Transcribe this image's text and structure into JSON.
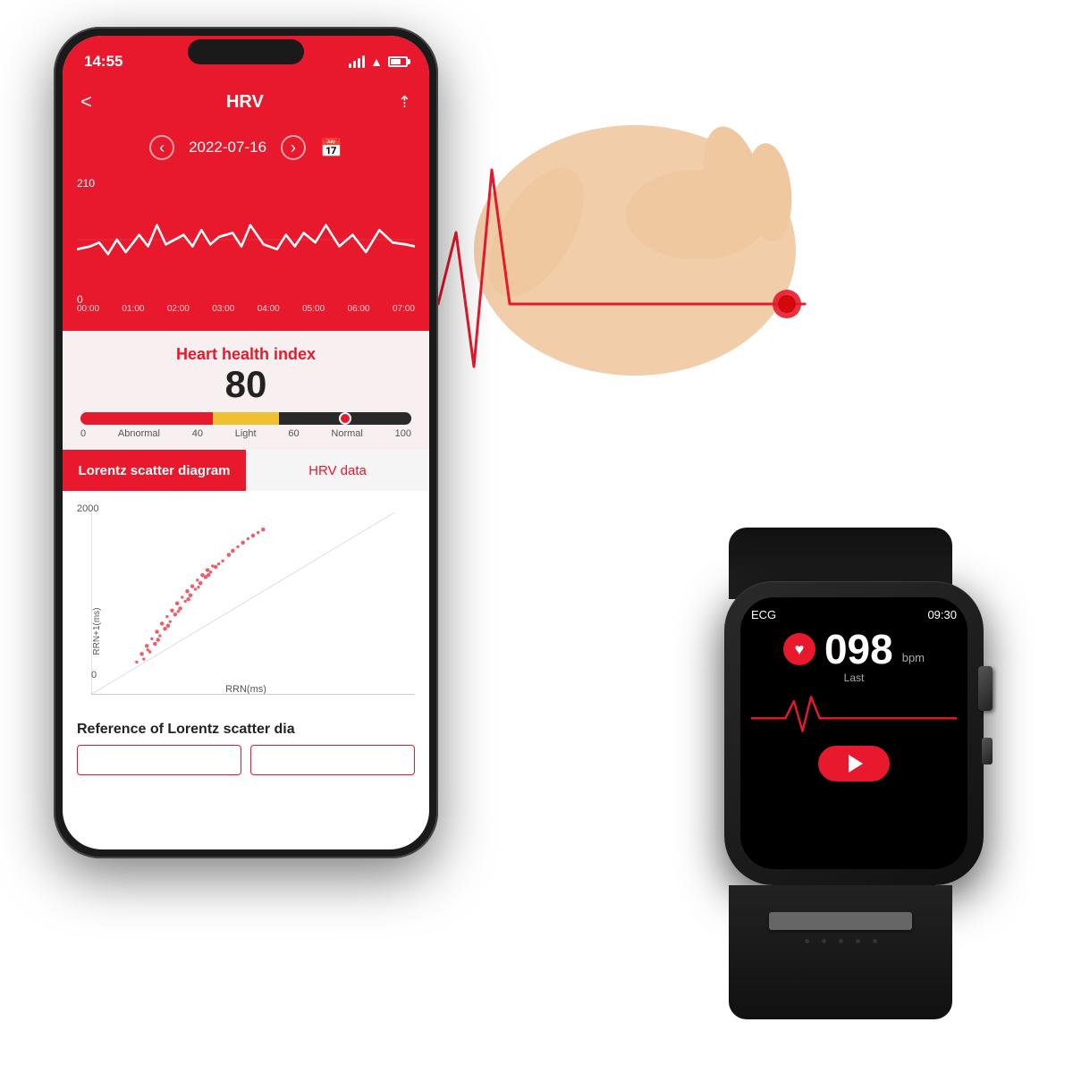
{
  "status_bar": {
    "time": "14:55",
    "signal": "signal",
    "wifi": "wifi",
    "battery": "battery"
  },
  "app": {
    "title": "HRV",
    "back_label": "<",
    "share_label": "share"
  },
  "date_nav": {
    "date": "2022-07-16",
    "prev_label": "<",
    "next_label": ">"
  },
  "chart": {
    "y_max": "210",
    "y_min": "0",
    "x_labels": [
      "00:00",
      "01:00",
      "02:00",
      "03:00",
      "04:00",
      "05:00",
      "06:00",
      "07:00"
    ]
  },
  "health_index": {
    "title": "Heart health index",
    "value": "80",
    "bar_labels": {
      "min": "0",
      "abnormal": "Abnormal",
      "v40": "40",
      "light": "Light",
      "v60": "60",
      "normal": "Normal",
      "max": "100"
    }
  },
  "tabs": {
    "tab1": "Lorentz scatter diagram",
    "tab2": "HRV data"
  },
  "lorentz": {
    "y_top": "2000",
    "y_zero": "0",
    "y_axis_label": "RRN+1(ms)",
    "x_label": "RRN(ms)"
  },
  "reference": {
    "title": "Reference of Lorentz scatter dia"
  },
  "watch": {
    "label": "ECG",
    "time": "09:30",
    "bpm": "098",
    "unit": "bpm",
    "last_label": "Last",
    "play_label": "play"
  }
}
